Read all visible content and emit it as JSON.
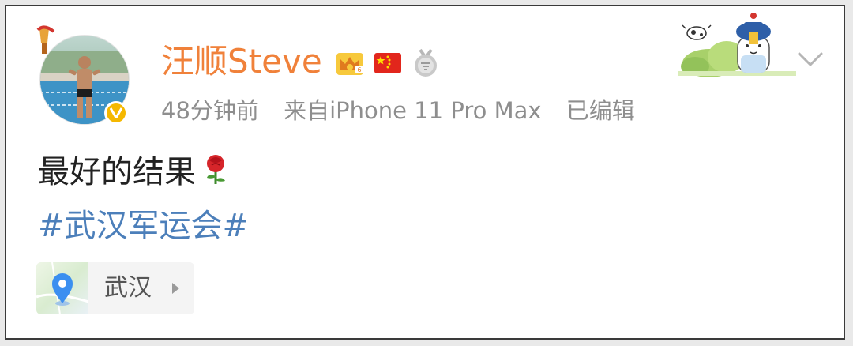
{
  "post": {
    "author": {
      "name": "汪顺Steve",
      "verified": true,
      "badges": [
        "crown-badge",
        "china-flag-badge",
        "medal-badge"
      ]
    },
    "meta": {
      "time": "48分钟前",
      "source": "来自iPhone 11 Pro Max",
      "edited": "已编辑"
    },
    "text": "最好的结果",
    "emoji": "rose-icon",
    "hashtag": "#武汉军运会#",
    "location": {
      "name": "武汉"
    }
  },
  "colors": {
    "username": "#f0813a",
    "meta": "#8e8e8e",
    "hashtag": "#4c7fba",
    "verified": "#f5b800",
    "location_pin": "#3b8ff0"
  }
}
